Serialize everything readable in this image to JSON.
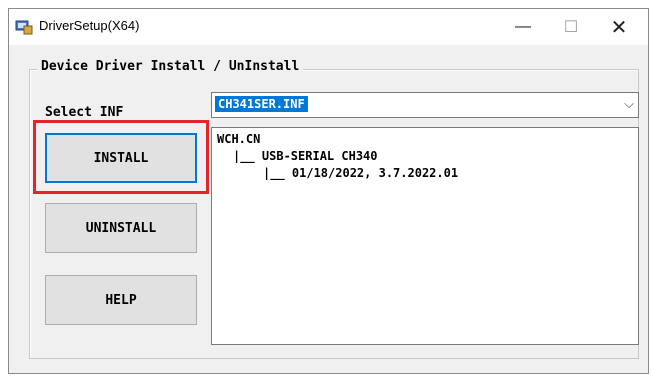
{
  "window": {
    "title": "DriverSetup(X64)",
    "controls": {
      "minimize": "—",
      "maximize": "☐",
      "close": "✕"
    }
  },
  "group": {
    "title": "Device Driver Install / UnInstall"
  },
  "select": {
    "label": "Select INF",
    "value": "CH341SER.INF",
    "arrow": "⌵"
  },
  "buttons": {
    "install": "INSTALL",
    "uninstall": "UNINSTALL",
    "help": "HELP"
  },
  "tree": {
    "line1": "WCH.CN",
    "line2": "|__ USB-SERIAL CH340",
    "line3": "|__ 01/18/2022, 3.7.2022.01"
  },
  "colors": {
    "highlight": "#e3242b",
    "selection": "#0078d7"
  }
}
